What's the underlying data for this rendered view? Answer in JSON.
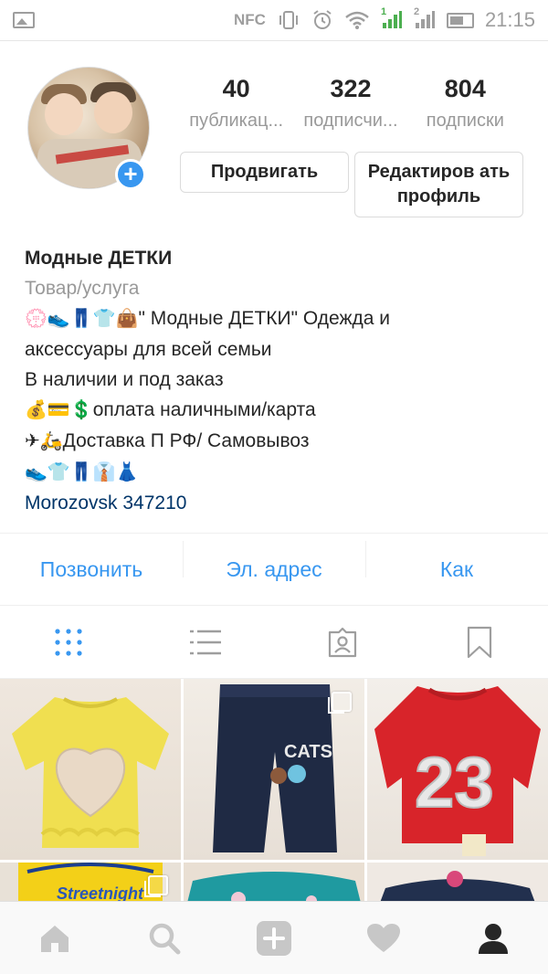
{
  "status_bar": {
    "nfc": "NFC",
    "time": "21:15",
    "sim1": "1",
    "sim2": "2"
  },
  "profile": {
    "stats": [
      {
        "value": "40",
        "label": "публикац..."
      },
      {
        "value": "322",
        "label": "подписчи..."
      },
      {
        "value": "804",
        "label": "подписки"
      }
    ],
    "promote_label": "Продвигать",
    "edit_label": "Редактиров ать профиль",
    "add_badge": "+"
  },
  "bio": {
    "name": "Модные ДЕТКИ",
    "category": "Товар/услуга",
    "line1_emoji": "💮👟👖👕👜",
    "line1_text": "\" Модные ДЕТКИ\" Одежда и",
    "line2_text": "аксессуары для всей семьи",
    "line3_text": "В наличии и под заказ",
    "line4_emoji": "💰💳💲",
    "line4_text": "оплата наличными/карта",
    "line5_emoji": "✈🛵",
    "line5_text": "Доставка П РФ/ Самовывоз",
    "line6_emoji": "👟👕👖👔👗",
    "location": "Morozovsk 347210"
  },
  "actions": [
    {
      "label": "Позвонить"
    },
    {
      "label": "Эл. адрес"
    },
    {
      "label": "Как"
    }
  ],
  "tabs": [
    {
      "icon": "grid-icon",
      "active": true
    },
    {
      "icon": "list-icon",
      "active": false
    },
    {
      "icon": "tagged-icon",
      "active": false
    },
    {
      "icon": "bookmark-icon",
      "active": false
    }
  ],
  "grid_tiles": [
    {
      "desc": "yellow-sweater",
      "multi": false
    },
    {
      "desc": "navy-cats-pants",
      "multi": true
    },
    {
      "desc": "red-23-sweater",
      "multi": false
    },
    {
      "desc": "yellow-tshirt",
      "multi": true
    },
    {
      "desc": "teal-sweater",
      "multi": false
    },
    {
      "desc": "navy-sweater",
      "multi": false
    }
  ],
  "tile_text": {
    "cats": "CATS",
    "number": "23",
    "streetnight": "Streetnight"
  },
  "bottom_nav": [
    "home-icon",
    "search-icon",
    "add-icon",
    "heart-icon",
    "profile-icon"
  ],
  "colors": {
    "accent": "#3897f0",
    "text": "#262626",
    "muted": "#999999",
    "link": "#003569",
    "active_nav": "#262626",
    "inactive_nav": "#c7c7c7"
  }
}
